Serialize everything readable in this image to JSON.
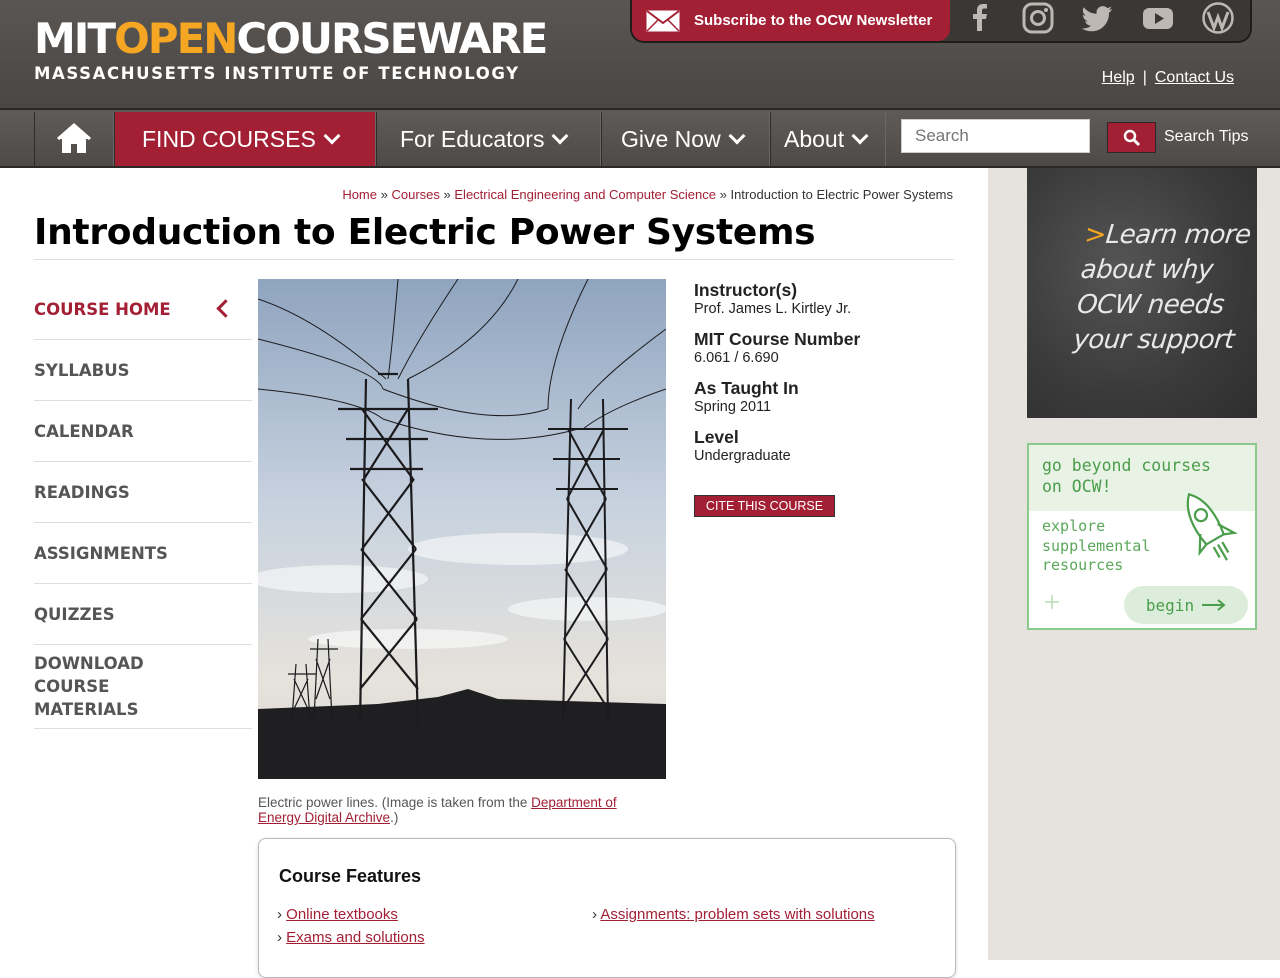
{
  "logo": {
    "part1": "MIT",
    "part2": "OPEN",
    "part3": "COURSEWARE",
    "subtitle": "MASSACHUSETTS INSTITUTE OF TECHNOLOGY"
  },
  "topbar": {
    "subscribe_label": "Subscribe to the OCW Newsletter",
    "social_icons": [
      "facebook-icon",
      "instagram-icon",
      "twitter-icon",
      "youtube-icon",
      "wordpress-icon"
    ],
    "help_label": "Help",
    "separator": "|",
    "contact_label": "Contact Us"
  },
  "nav": {
    "items": [
      "FIND COURSES",
      "For Educators",
      "Give Now",
      "About"
    ],
    "search_placeholder": "Search",
    "search_tips_label": "Search Tips"
  },
  "breadcrumb": {
    "items": [
      "Home",
      "Courses",
      "Electrical Engineering and Computer Science"
    ],
    "separator": "»",
    "current": "Introduction to Electric Power Systems"
  },
  "page_title": "Introduction to Electric Power Systems",
  "sidebar": {
    "items": [
      "COURSE HOME",
      "SYLLABUS",
      "CALENDAR",
      "READINGS",
      "ASSIGNMENTS",
      "QUIZZES",
      "DOWNLOAD COURSE MATERIALS"
    ]
  },
  "image": {
    "caption_text": "Electric power lines. (Image is taken from the ",
    "caption_link": "Department of Energy Digital Archive",
    "caption_end": ".)"
  },
  "course_info": {
    "instructor_label": "Instructor(s)",
    "instructor": "Prof. James L. Kirtley Jr.",
    "number_label": "MIT Course Number",
    "number": "6.061 / 6.690",
    "taught_label": "As Taught In",
    "taught": "Spring 2011",
    "level_label": "Level",
    "level": "Undergraduate",
    "cite_label": "CITE THIS COURSE"
  },
  "features": {
    "title": "Course Features",
    "items": [
      "Online textbooks",
      "Assignments: problem sets with solutions",
      "Exams and solutions"
    ],
    "bullet": "›"
  },
  "promo": {
    "chalk_arrow": ">",
    "chalk_line1": "Learn more",
    "chalk_line2": "about why",
    "chalk_line3": "OCW needs",
    "chalk_line4": "your support",
    "beyond_line1": "go beyond courses",
    "beyond_line2": "on OCW!",
    "explore_line1": "explore",
    "explore_line2": "supplemental",
    "explore_line3": "resources",
    "begin_label": "begin"
  },
  "colors": {
    "brand_red": "#a31f34",
    "header_gray": "#4e4a48",
    "orange": "#f5a623",
    "green": "#4a9d4a"
  }
}
